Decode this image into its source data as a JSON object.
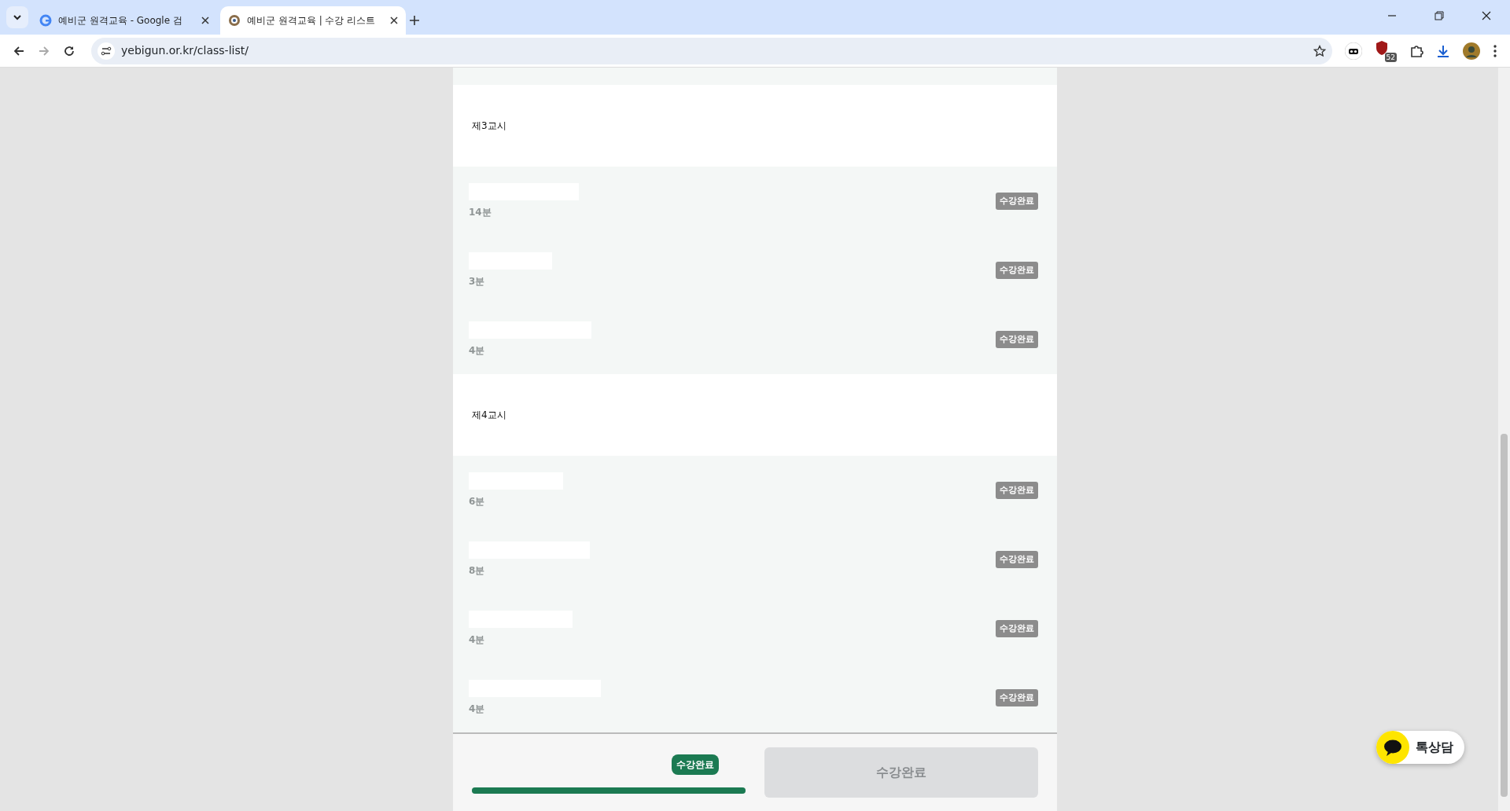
{
  "browser": {
    "tabs": [
      {
        "title": "예비군 원격교육 - Google 검",
        "selected": false
      },
      {
        "title": "예비군 원격교육 | 수강 리스트",
        "selected": true
      }
    ],
    "url": "yebigun.or.kr/class-list/",
    "extension_badge": "52"
  },
  "sections": [
    {
      "title": "제3교시",
      "lessons": [
        {
          "duration": "14분",
          "status": "수강완료"
        },
        {
          "duration": "3분",
          "status": "수강완료"
        },
        {
          "duration": "4분",
          "status": "수강완료"
        }
      ]
    },
    {
      "title": "제4교시",
      "lessons": [
        {
          "duration": "6분",
          "status": "수강완료"
        },
        {
          "duration": "8분",
          "status": "수강완료"
        },
        {
          "duration": "4분",
          "status": "수강완료"
        },
        {
          "duration": "4분",
          "status": "수강완료"
        }
      ]
    }
  ],
  "footer": {
    "progress_label": "수강완료",
    "level": 1,
    "button": {
      "label": "수강완료",
      "disabled": true
    }
  },
  "chat_button": {
    "label": "톡상담"
  }
}
